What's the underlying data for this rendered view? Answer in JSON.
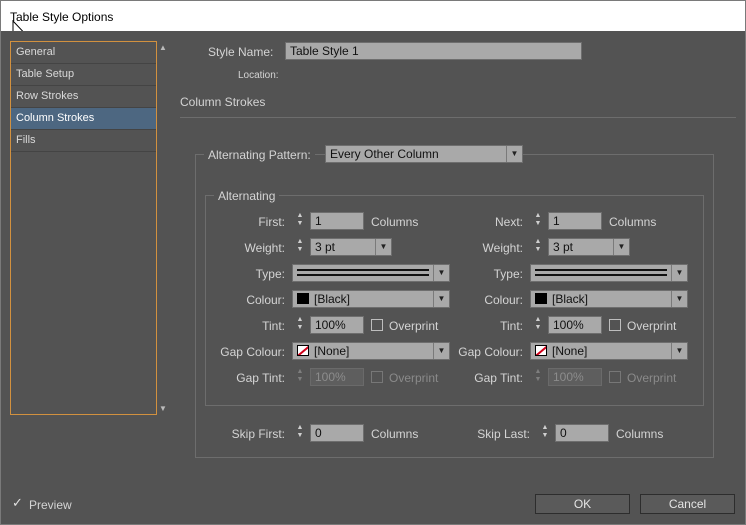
{
  "window": {
    "title": "Table Style Options"
  },
  "sidebar": {
    "items": [
      {
        "label": "General",
        "selected": false
      },
      {
        "label": "Table Setup",
        "selected": false
      },
      {
        "label": "Row Strokes",
        "selected": false
      },
      {
        "label": "Column Strokes",
        "selected": true
      },
      {
        "label": "Fills",
        "selected": false
      }
    ]
  },
  "header": {
    "style_name_label": "Style Name:",
    "style_name_value": "Table Style 1",
    "location_label": "Location:",
    "section_title": "Column Strokes"
  },
  "pattern": {
    "label": "Alternating Pattern:",
    "value": "Every Other Column"
  },
  "alternating": {
    "group_label": "Alternating",
    "first": {
      "count_label": "First:",
      "count_value": "1",
      "count_unit": "Columns",
      "weight_label": "Weight:",
      "weight_value": "3 pt",
      "type_label": "Type:",
      "colour_label": "Colour:",
      "colour_value": "[Black]",
      "tint_label": "Tint:",
      "tint_value": "100%",
      "overprint_label": "Overprint",
      "gap_colour_label": "Gap Colour:",
      "gap_colour_value": "[None]",
      "gap_tint_label": "Gap Tint:",
      "gap_tint_value": "100%",
      "gap_overprint_label": "Overprint"
    },
    "next": {
      "count_label": "Next:",
      "count_value": "1",
      "count_unit": "Columns",
      "weight_label": "Weight:",
      "weight_value": "3 pt",
      "type_label": "Type:",
      "colour_label": "Colour:",
      "colour_value": "[Black]",
      "tint_label": "Tint:",
      "tint_value": "100%",
      "overprint_label": "Overprint",
      "gap_colour_label": "Gap Colour:",
      "gap_colour_value": "[None]",
      "gap_tint_label": "Gap Tint:",
      "gap_tint_value": "100%",
      "gap_overprint_label": "Overprint"
    }
  },
  "skip": {
    "first_label": "Skip First:",
    "first_value": "0",
    "first_unit": "Columns",
    "last_label": "Skip Last:",
    "last_value": "0",
    "last_unit": "Columns"
  },
  "footer": {
    "preview_label": "Preview",
    "preview_checked": true,
    "ok_label": "OK",
    "cancel_label": "Cancel"
  },
  "colors": {
    "dialog_bg": "#535353",
    "selection": "#4d6781",
    "sidebar_border": "#d2913f"
  }
}
